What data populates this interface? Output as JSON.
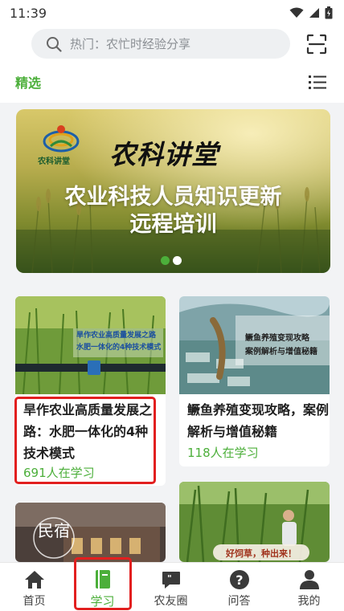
{
  "status_bar": {
    "time": "11:39"
  },
  "search": {
    "placeholder": "热门：农忙时经验分享"
  },
  "tabs": {
    "active_label": "精选"
  },
  "banner": {
    "logo_text": "农科讲堂",
    "brand": "农科讲堂",
    "title_line1": "农业科技人员知识更新",
    "title_line2": "远程培训",
    "dots": 2,
    "active_dot": 0
  },
  "cards": [
    {
      "image_text_line1": "旱作农业高质量发展之路",
      "image_text_line2": "水肥一体化的4种技术模式",
      "title": "旱作农业高质量发展之路：水肥一体化的4种技术模式",
      "learners": "691人在学习"
    },
    {
      "image_text_line1": "鳜鱼养殖变现攻略",
      "image_text_line2": "案例解析与增值秘籍",
      "title": "鳜鱼养殖变现攻略，案例解析与增值秘籍",
      "learners": "118人在学习"
    },
    {
      "image_text": "民宿"
    },
    {
      "image_text": "好饲草，种出来！"
    }
  ],
  "nav": [
    {
      "label": "首页",
      "icon": "home-icon"
    },
    {
      "label": "学习",
      "icon": "book-icon",
      "active": true
    },
    {
      "label": "农友圈",
      "icon": "chat-bubble-icon"
    },
    {
      "label": "问答",
      "icon": "question-icon"
    },
    {
      "label": "我的",
      "icon": "person-icon"
    }
  ],
  "colors": {
    "accent": "#4caf3a",
    "highlight": "#e21f1f",
    "background": "#f2f3f5"
  }
}
